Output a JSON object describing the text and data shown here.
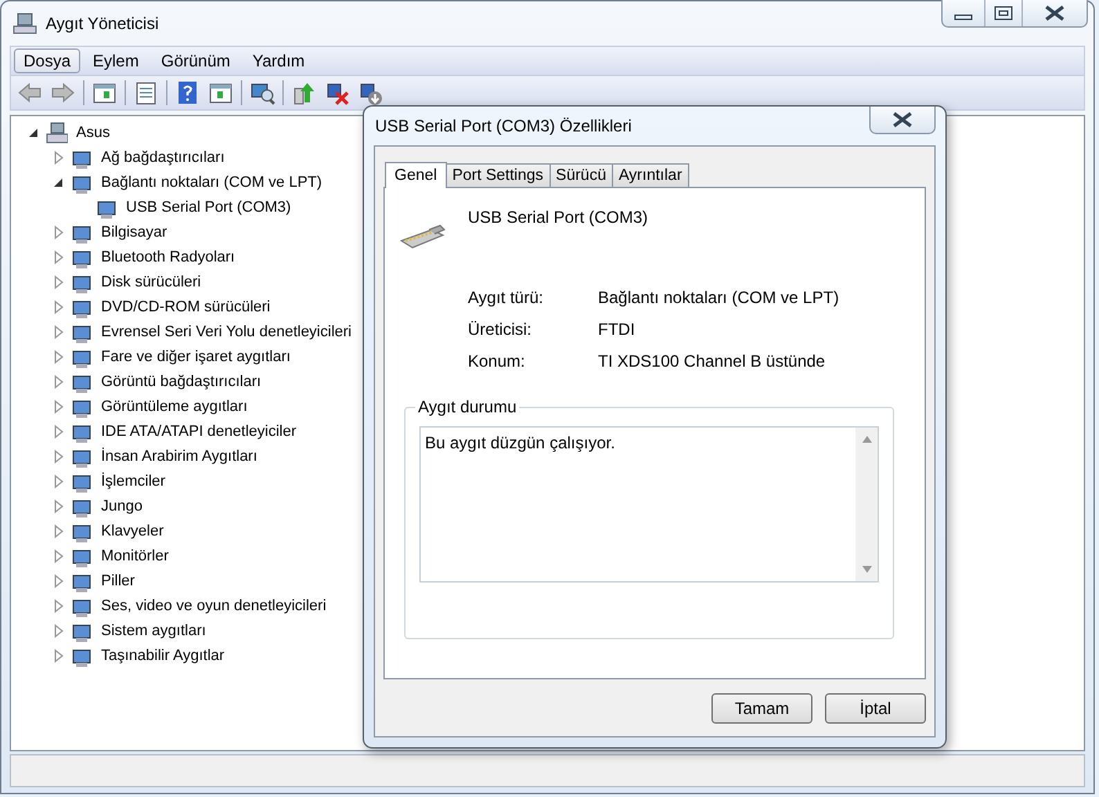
{
  "window": {
    "title": "Aygıt Yöneticisi"
  },
  "menu": [
    {
      "label": "Dosya",
      "selected": true
    },
    {
      "label": "Eylem",
      "selected": false
    },
    {
      "label": "Görünüm",
      "selected": false
    },
    {
      "label": "Yardım",
      "selected": false
    }
  ],
  "tree": [
    {
      "label": "Asus",
      "expanded": true,
      "children": [
        {
          "label": "Ağ bağdaştırıcıları",
          "expanded": false
        },
        {
          "label": "Bağlantı noktaları (COM ve LPT)",
          "expanded": true,
          "children": [
            {
              "label": "USB Serial Port (COM3)"
            }
          ]
        },
        {
          "label": "Bilgisayar",
          "expanded": false
        },
        {
          "label": "Bluetooth Radyoları",
          "expanded": false
        },
        {
          "label": "Disk sürücüleri",
          "expanded": false
        },
        {
          "label": "DVD/CD-ROM sürücüleri",
          "expanded": false
        },
        {
          "label": "Evrensel Seri Veri Yolu denetleyicileri",
          "expanded": false
        },
        {
          "label": "Fare ve diğer işaret aygıtları",
          "expanded": false
        },
        {
          "label": "Görüntü bağdaştırıcıları",
          "expanded": false
        },
        {
          "label": "Görüntüleme aygıtları",
          "expanded": false
        },
        {
          "label": "IDE ATA/ATAPI denetleyiciler",
          "expanded": false
        },
        {
          "label": "İnsan Arabirim Aygıtları",
          "expanded": false
        },
        {
          "label": "İşlemciler",
          "expanded": false
        },
        {
          "label": "Jungo",
          "expanded": false
        },
        {
          "label": "Klavyeler",
          "expanded": false
        },
        {
          "label": "Monitörler",
          "expanded": false
        },
        {
          "label": "Piller",
          "expanded": false
        },
        {
          "label": "Ses, video ve oyun denetleyicileri",
          "expanded": false
        },
        {
          "label": "Sistem aygıtları",
          "expanded": false
        },
        {
          "label": "Taşınabilir Aygıtlar",
          "expanded": false
        }
      ]
    }
  ],
  "dialog": {
    "title": "USB Serial Port (COM3) Özellikleri",
    "tabs": [
      {
        "label": "Genel",
        "selected": true
      },
      {
        "label": "Port Settings",
        "selected": false
      },
      {
        "label": "Sürücü",
        "selected": false
      },
      {
        "label": "Ayrıntılar",
        "selected": false
      }
    ],
    "device_name": "USB Serial Port (COM3)",
    "properties": [
      {
        "label": "Aygıt türü:",
        "value": "Bağlantı noktaları (COM ve LPT)"
      },
      {
        "label": "Üreticisi:",
        "value": "FTDI"
      },
      {
        "label": "Konum:",
        "value": "TI XDS100 Channel B üstünde"
      }
    ],
    "status_group": {
      "title": "Aygıt durumu",
      "text": "Bu aygıt düzgün çalışıyor."
    },
    "buttons": [
      "Tamam",
      "İptal"
    ]
  }
}
